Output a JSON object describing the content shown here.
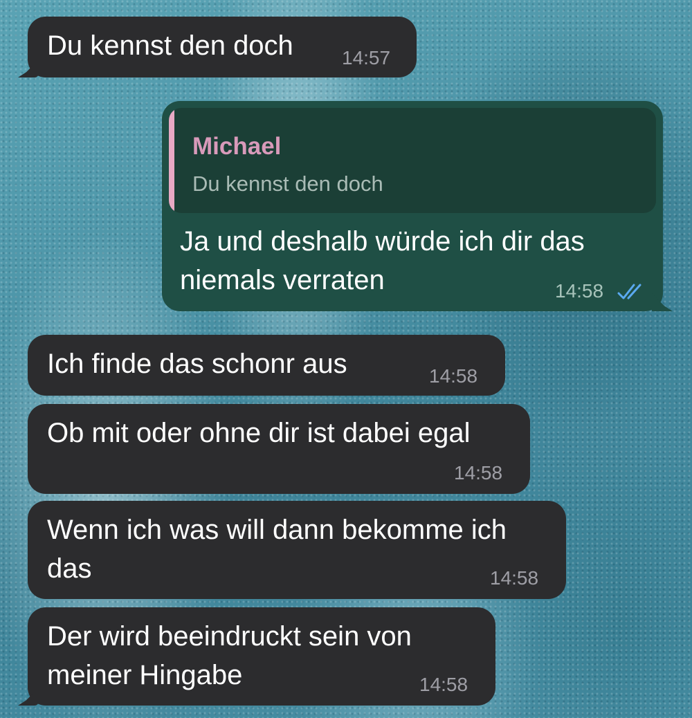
{
  "messages": [
    {
      "text": "Du kennst den doch",
      "time": "14:57"
    },
    {
      "quote_name": "Michael",
      "quote_text": "Du kennst den doch",
      "line1": "Ja und deshalb würde ich dir das",
      "line2": "niemals verraten",
      "time": "14:58",
      "status": "read"
    },
    {
      "text": "Ich finde das schonr aus",
      "time": "14:58"
    },
    {
      "text": "Ob mit oder ohne dir ist dabei egal",
      "time": "14:58"
    },
    {
      "line1": "Wenn ich was will dann bekomme ich",
      "line2": "das",
      "time": "14:58"
    },
    {
      "line1": "Der wird beeindruckt sein von",
      "line2": "meiner Hingabe",
      "time": "14:58"
    }
  ],
  "colors": {
    "incoming_bubble": "#2c2c2e",
    "outgoing_bubble": "#1f4f45",
    "quote_accent": "#e8a9c4",
    "read_check": "#5aa9f0"
  },
  "icons": {
    "read_receipt": "double-check-icon"
  }
}
